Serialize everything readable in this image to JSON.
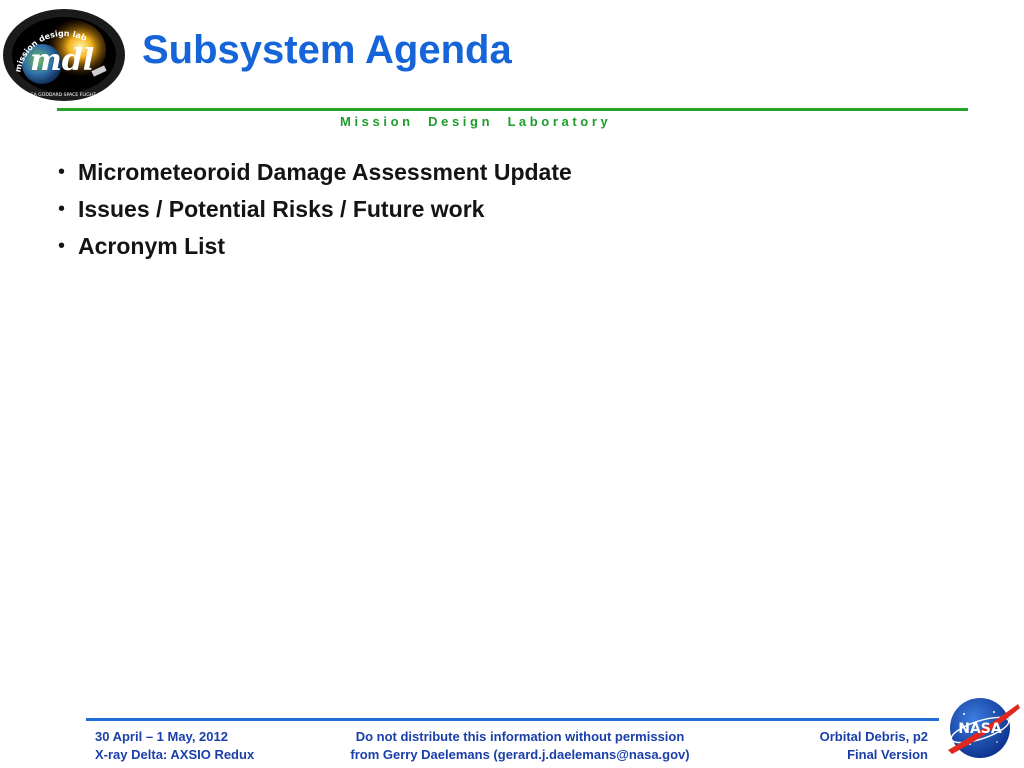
{
  "slide": {
    "title": "Subsystem Agenda",
    "subtitle": "M i s s i o n     D e s i g n     L a b o r a t o r y",
    "bullets": [
      {
        "label": "Micrometeoroid Damage Assessment Update"
      },
      {
        "label": "Issues / Potential Risks / Future work"
      },
      {
        "label": "Acronym List"
      }
    ],
    "bullet_glyph": "•"
  },
  "footer": {
    "left_line1": "30 April – 1 May, 2012",
    "left_line2": "X-ray Delta: AXSIO Redux",
    "center_line1": "Do not distribute this information without permission",
    "center_line2": "from Gerry Daelemans (gerard.j.daelemans@nasa.gov)",
    "right_line1": "Orbital Debris, p2",
    "right_line2": "Final Version"
  },
  "logos": {
    "mdl_logo": {
      "icon": "mdl-logo-icon",
      "text": "mdl",
      "ring_text": "mission design lab — NASA GODDARD SPACE FLIGHT CENTER"
    },
    "nasa_logo": {
      "icon": "nasa-meatball-icon",
      "text": "NASA"
    }
  },
  "colors": {
    "title": "#1565d8",
    "header_rule": "#27a327",
    "subtitle": "#1f9c2b",
    "footer_rule": "#1f6fd6",
    "footer_text": "#1a3fa8"
  }
}
